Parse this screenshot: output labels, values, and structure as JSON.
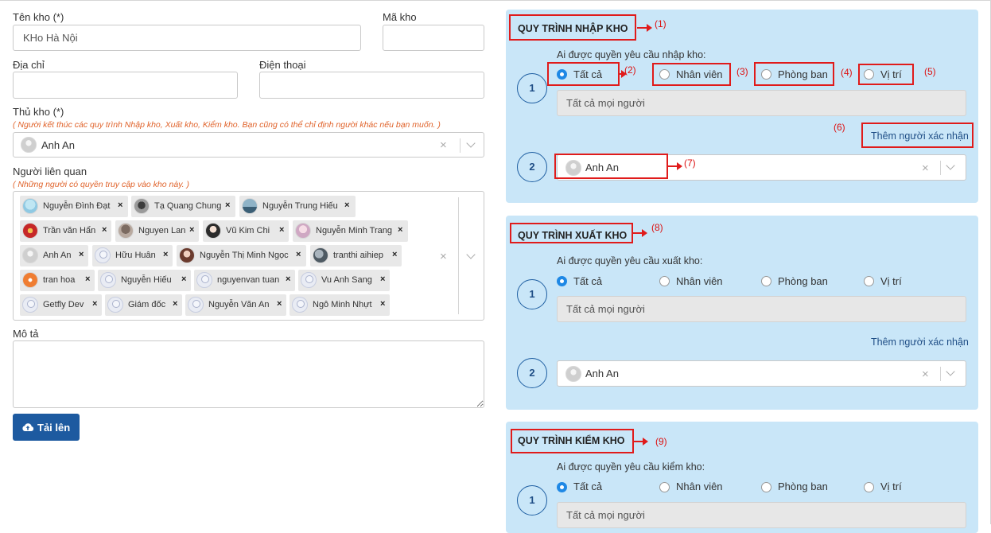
{
  "form": {
    "warehouse_name_label": "Tên kho (*)",
    "warehouse_name_value": "KHo Hà Nội",
    "warehouse_code_label": "Mã kho",
    "address_label": "Địa chỉ",
    "phone_label": "Điện thoại",
    "keeper_label": "Thủ kho (*)",
    "keeper_hint": "( Người kết thúc các quy trình Nhập kho, Xuất kho, Kiểm kho. Bạn cũng có thể chỉ định người khác nếu bạn muốn. )",
    "keeper_value": "Anh An",
    "related_label": "Người liên quan",
    "related_hint": "( Những người có quyền truy cập vào kho này. )",
    "related_people": [
      "Nguyễn Đình Đạt",
      "Tạ Quang Chung",
      "Nguyễn Trung Hiếu",
      "Trần văn Hẩn",
      "Nguyen Lan",
      "Vũ Kim Chi",
      "Nguyễn Minh Trang",
      "Anh An",
      "Hữu Huân",
      "Nguyễn Thị Minh Ngọc",
      "tranthi aihiep",
      "tran hoa",
      "Nguyễn Hiếu",
      "nguyenvan tuan",
      "Vu Anh Sang",
      "Getfly Dev",
      "Giám đốc",
      "Nguyễn Văn An",
      "Ngô Minh Nhựt"
    ],
    "remove_glyph": "×",
    "description_label": "Mô tả",
    "upload_label": "Tải lên"
  },
  "options": {
    "all": "Tất cả",
    "staff": "Nhân viên",
    "department": "Phòng ban",
    "position": "Vị trí"
  },
  "everyone_text": "Tất cả mọi người",
  "add_confirmer": "Thêm người xác nhận",
  "import": {
    "title": "QUY TRÌNH NHẬP KHO",
    "question": "Ai được quyền yêu cầu nhập kho:",
    "step1": "1",
    "step2": "2",
    "approver": "Anh An"
  },
  "export": {
    "title": "QUY TRÌNH XUẤT KHO",
    "question": "Ai được quyền yêu cầu xuất kho:",
    "step1": "1",
    "step2": "2",
    "approver": "Anh An"
  },
  "inventory": {
    "title": "QUY TRÌNH KIỂM KHO",
    "question": "Ai được quyền yêu cầu kiểm kho:",
    "step1": "1"
  },
  "annotations": [
    "(1)",
    "(2)",
    "(3)",
    "(4)",
    "(5)",
    "(6)",
    "(7)",
    "(8)",
    "(9)"
  ],
  "colors": {
    "panel_bg": "#c9e6f8",
    "button_blue": "#1d5aa0",
    "annotation_red": "#e01b1b",
    "radio_blue": "#1e88e5",
    "hint_orange": "#e0632b"
  }
}
